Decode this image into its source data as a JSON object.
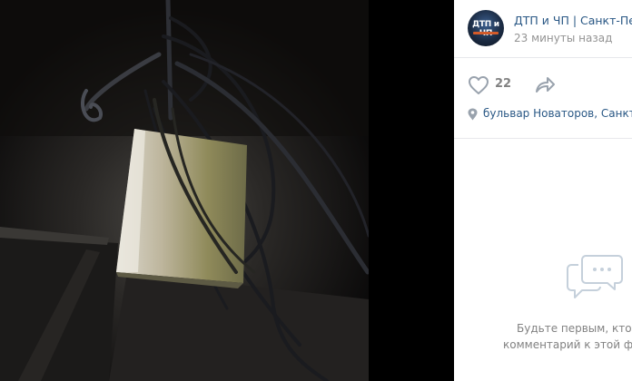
{
  "post": {
    "group_name": "ДТП и ЧП | Санкт-Пет",
    "time": "23 минуты назад",
    "avatar_text": "ДТП и ЧП",
    "likes": "22",
    "location": "бульвар Новаторов, Санкт-"
  },
  "comments": {
    "empty_line1": "Будьте первым, кто с",
    "empty_line2": "комментарий к этой ф"
  },
  "icons": {
    "like": "heart-icon",
    "share": "share-arrow-icon",
    "location": "map-pin-icon",
    "empty_comments": "chat-bubbles-icon"
  },
  "colors": {
    "link": "#2a5885",
    "muted": "#939393",
    "icon": "#99a2ad"
  }
}
